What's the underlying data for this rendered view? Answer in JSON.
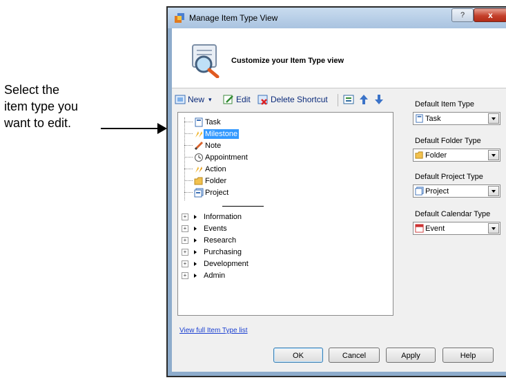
{
  "callout": {
    "lines": [
      "Select the",
      "item type you",
      "want to edit."
    ]
  },
  "window": {
    "title": "Manage Item Type View",
    "help_glyph": "?",
    "close_glyph": "x"
  },
  "header": {
    "text": "Customize your Item Type view"
  },
  "toolbar": {
    "new_label": "New",
    "edit_label": "Edit",
    "delete_label": "Delete Shortcut"
  },
  "tree": {
    "items": [
      {
        "label": "Task",
        "icon": "task-icon"
      },
      {
        "label": "Milestone",
        "icon": "milestone-icon",
        "selected": true
      },
      {
        "label": "Note",
        "icon": "pencil-note-icon"
      },
      {
        "label": "Appointment",
        "icon": "clock-icon"
      },
      {
        "label": "Action",
        "icon": "action-icon"
      },
      {
        "label": "Folder",
        "icon": "folder-icon"
      },
      {
        "label": "Project",
        "icon": "project-icon"
      }
    ],
    "groups": [
      "Information",
      "Events",
      "Research",
      "Purchasing",
      "Development",
      "Admin"
    ]
  },
  "defaults": {
    "item_type_label": "Default Item Type",
    "item_type_value": "Task",
    "folder_type_label": "Default Folder Type",
    "folder_type_value": "Folder",
    "project_type_label": "Default Project Type",
    "project_type_value": "Project",
    "calendar_type_label": "Default Calendar Type",
    "calendar_type_value": "Event"
  },
  "link": {
    "text": "View full Item Type list"
  },
  "buttons": {
    "ok": "OK",
    "cancel": "Cancel",
    "apply": "Apply",
    "help": "Help"
  },
  "colors": {
    "selection": "#3399ff",
    "link": "#1a3fd1",
    "close": "#c4402b"
  }
}
